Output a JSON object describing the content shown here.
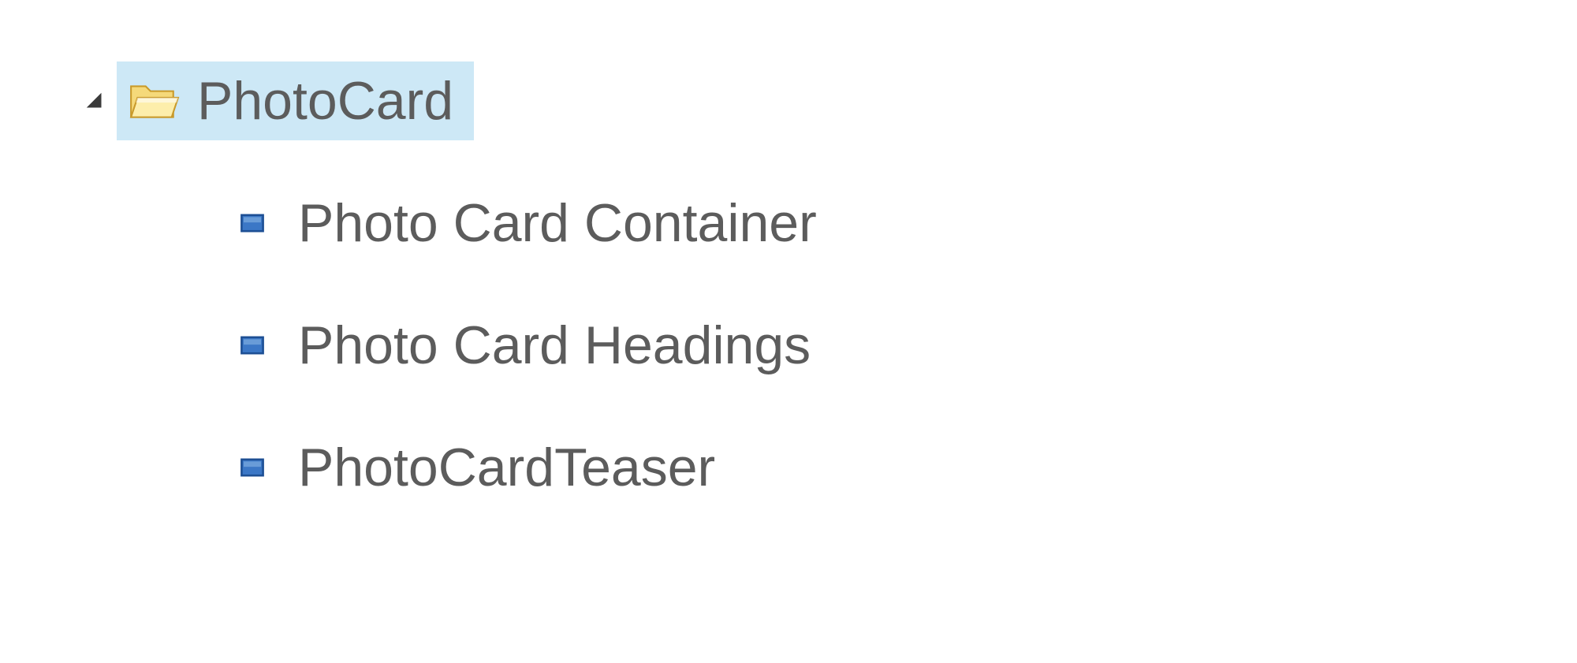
{
  "tree": {
    "parent": {
      "label": "PhotoCard",
      "expanded": true,
      "selected": true
    },
    "children": [
      {
        "label": "Photo Card Container"
      },
      {
        "label": "Photo Card Headings"
      },
      {
        "label": "PhotoCardTeaser"
      }
    ]
  },
  "colors": {
    "selection": "#cde8f6",
    "text": "#5c5c5c",
    "nodeBlue": "#2f6fc1",
    "folderFill": "#f9e28b",
    "folderStroke": "#c99a2a"
  }
}
